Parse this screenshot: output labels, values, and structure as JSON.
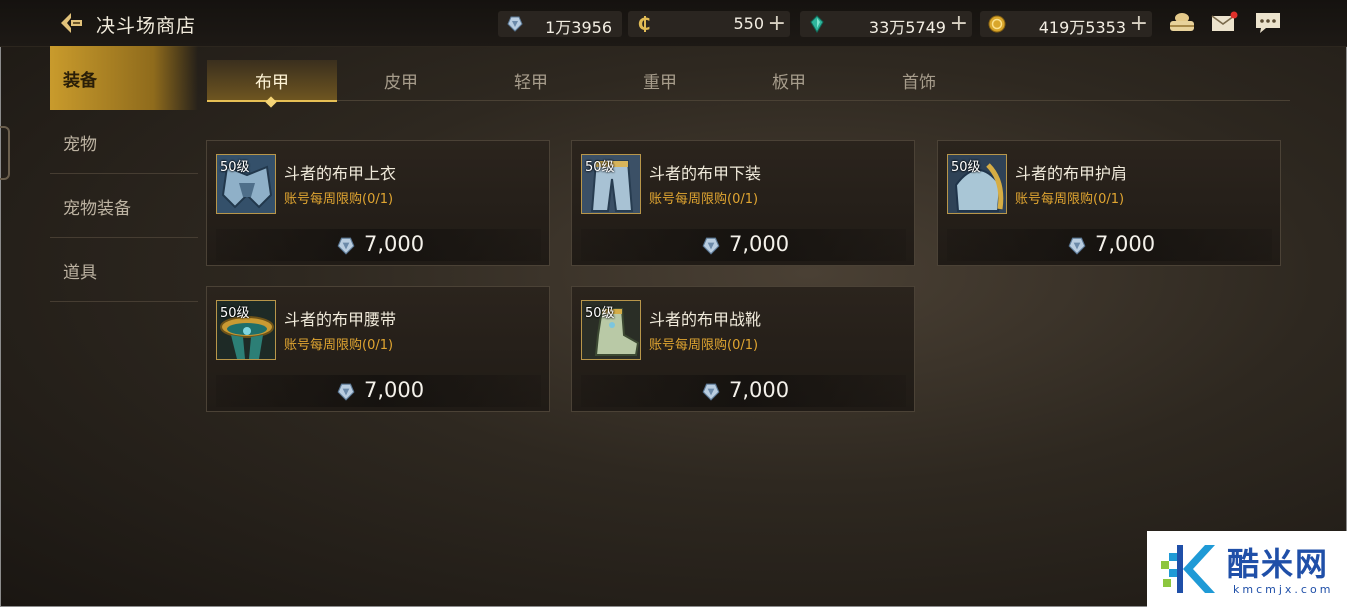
{
  "header": {
    "title": "决斗场商店",
    "back_icon": "back-arrow-icon"
  },
  "currencies": [
    {
      "icon": "crystal-token-icon",
      "value": "1万3956",
      "plus": ""
    },
    {
      "icon": "coin-c-icon",
      "value": "550",
      "plus": "+"
    },
    {
      "icon": "green-gem-icon",
      "value": "33万5749",
      "plus": "+"
    },
    {
      "icon": "gold-coin-icon",
      "value": "419万5353",
      "plus": "+"
    }
  ],
  "top_icons": [
    "treasure-chest-icon",
    "mail-icon",
    "chat-icon"
  ],
  "sidebar": {
    "items": [
      {
        "label": "装备",
        "active": true
      },
      {
        "label": "宠物",
        "active": false
      },
      {
        "label": "宠物装备",
        "active": false
      },
      {
        "label": "道具",
        "active": false
      }
    ]
  },
  "tabs": [
    {
      "label": "布甲",
      "active": true
    },
    {
      "label": "皮甲",
      "active": false
    },
    {
      "label": "轻甲",
      "active": false
    },
    {
      "label": "重甲",
      "active": false
    },
    {
      "label": "板甲",
      "active": false
    },
    {
      "label": "首饰",
      "active": false
    }
  ],
  "items": [
    {
      "level": "50级",
      "name": "斗者的布甲上衣",
      "limit": "账号每周限购(0/1)",
      "price": "7,000",
      "icon": "cloth-top-icon"
    },
    {
      "level": "50级",
      "name": "斗者的布甲下装",
      "limit": "账号每周限购(0/1)",
      "price": "7,000",
      "icon": "cloth-pants-icon"
    },
    {
      "level": "50级",
      "name": "斗者的布甲护肩",
      "limit": "账号每周限购(0/1)",
      "price": "7,000",
      "icon": "cloth-shoulder-icon"
    },
    {
      "level": "50级",
      "name": "斗者的布甲腰带",
      "limit": "账号每周限购(0/1)",
      "price": "7,000",
      "icon": "cloth-belt-icon"
    },
    {
      "level": "50级",
      "name": "斗者的布甲战靴",
      "limit": "账号每周限购(0/1)",
      "price": "7,000",
      "icon": "cloth-boots-icon"
    }
  ],
  "watermark": {
    "text": "酷米网",
    "sub": "kmcmjx.com"
  },
  "colors": {
    "accent_gold": "#e6bf55",
    "limit_orange": "#e0a531",
    "sidebar_active": "#c99b2c"
  }
}
